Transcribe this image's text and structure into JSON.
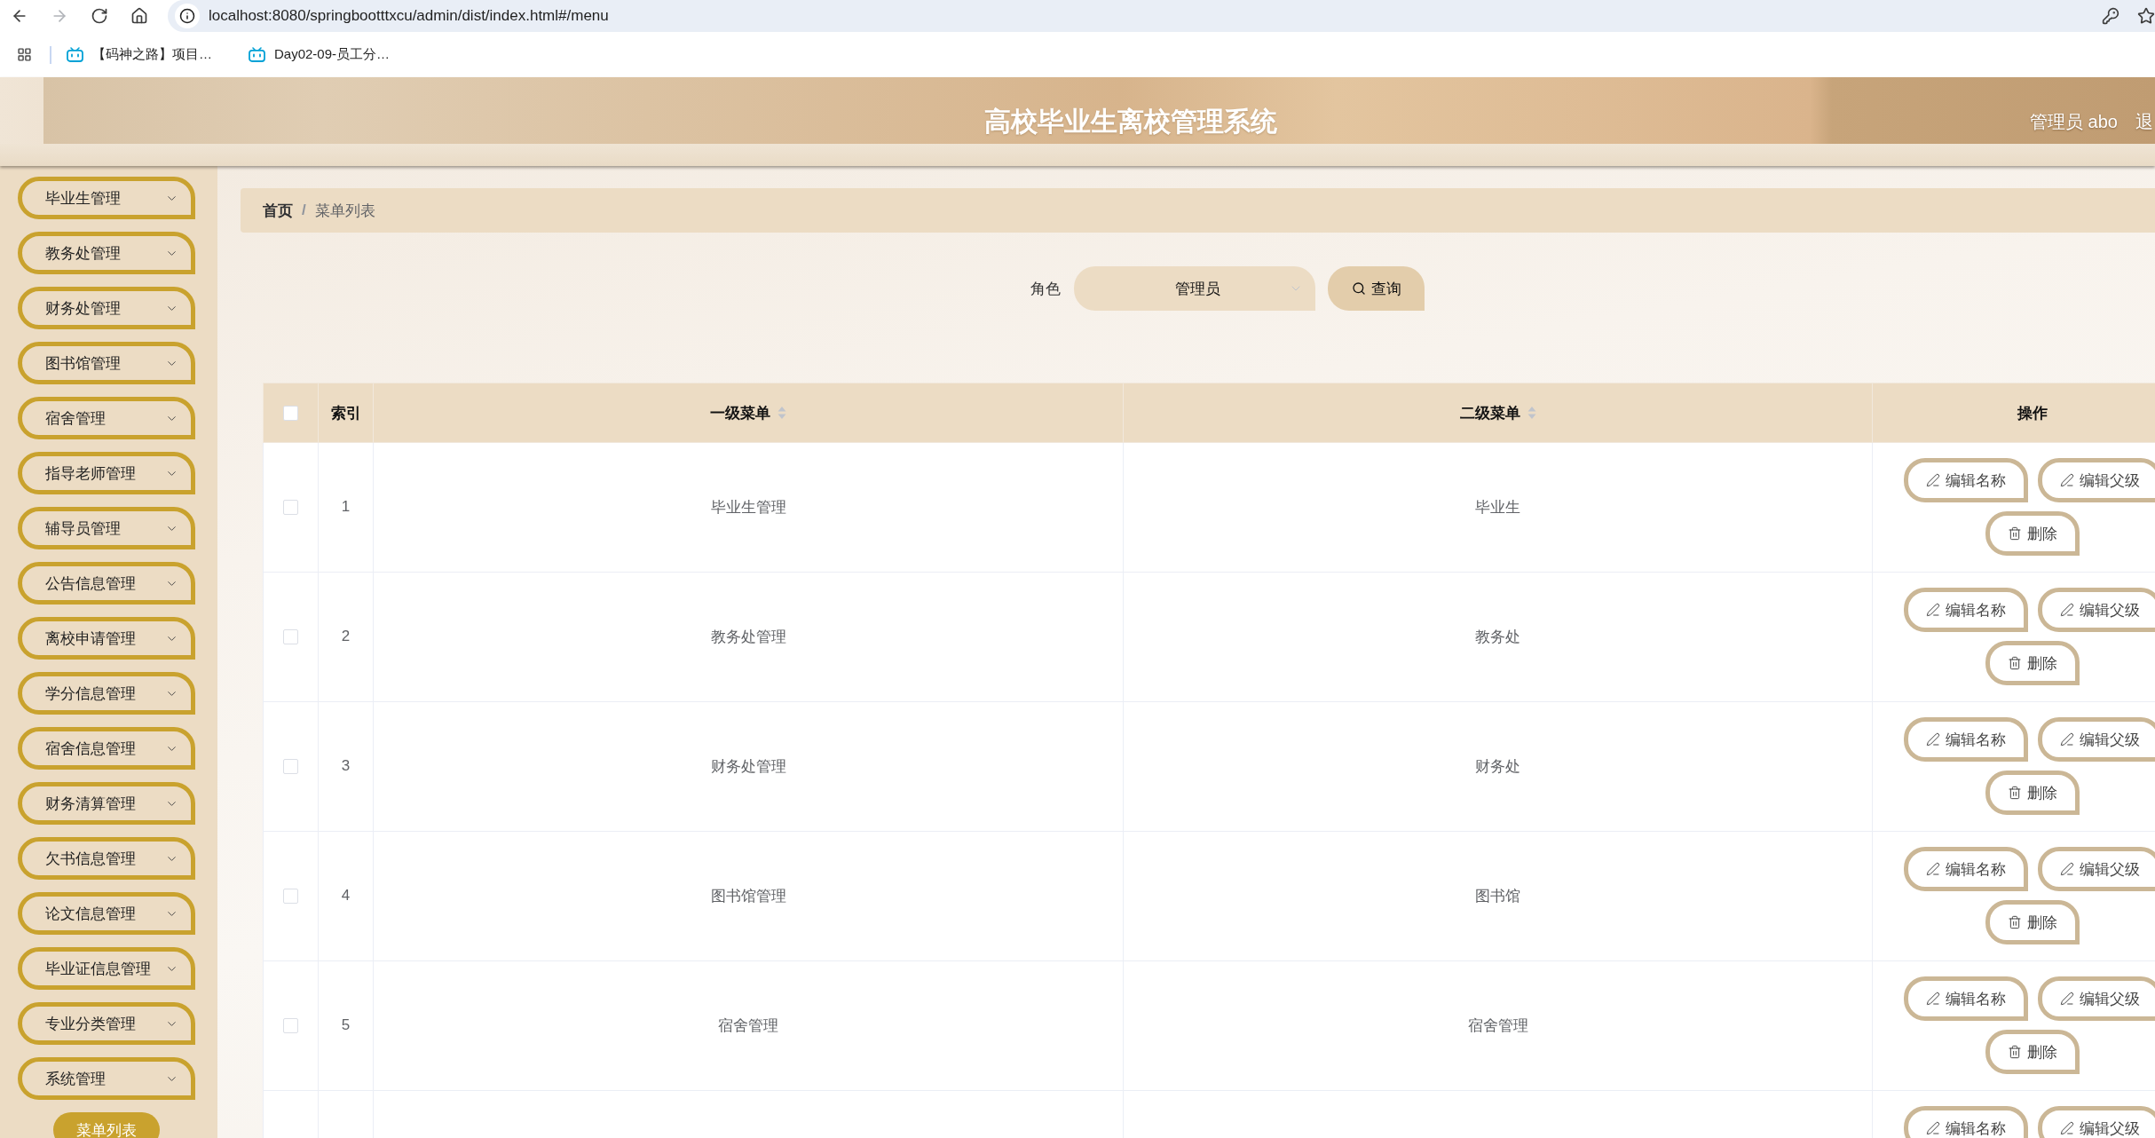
{
  "browser": {
    "url": "localhost:8080/springbootttxcu/admin/dist/index.html#/menu",
    "bookmarks": [
      {
        "label": "【码神之路】项目…"
      },
      {
        "label": "Day02-09-员工分…"
      }
    ]
  },
  "header": {
    "title": "高校毕业生离校管理系统",
    "user": "管理员 abo",
    "logout": "退"
  },
  "sidebar": {
    "items": [
      {
        "label": "毕业生管理"
      },
      {
        "label": "教务处管理"
      },
      {
        "label": "财务处管理"
      },
      {
        "label": "图书馆管理"
      },
      {
        "label": "宿舍管理"
      },
      {
        "label": "指导老师管理"
      },
      {
        "label": "辅导员管理"
      },
      {
        "label": "公告信息管理"
      },
      {
        "label": "离校申请管理"
      },
      {
        "label": "学分信息管理"
      },
      {
        "label": "宿舍信息管理"
      },
      {
        "label": "财务清算管理"
      },
      {
        "label": "欠书信息管理"
      },
      {
        "label": "论文信息管理"
      },
      {
        "label": "毕业证信息管理"
      },
      {
        "label": "专业分类管理"
      },
      {
        "label": "系统管理",
        "children": [
          {
            "label": "菜单列表",
            "selected": true
          }
        ]
      }
    ]
  },
  "breadcrumb": {
    "items": [
      "首页",
      "菜单列表"
    ],
    "separator": "/"
  },
  "search": {
    "label": "角色",
    "select": {
      "value": "管理员"
    },
    "button": "查询"
  },
  "table": {
    "columns": [
      {
        "kind": "checkbox",
        "checked": false
      },
      {
        "kind": "text",
        "label": "索引",
        "sortable": false
      },
      {
        "kind": "text",
        "label": "一级菜单",
        "sortable": true
      },
      {
        "kind": "text",
        "label": "二级菜单",
        "sortable": true
      },
      {
        "kind": "text",
        "label": "操作",
        "sortable": false
      }
    ],
    "rows": [
      {
        "checked": false,
        "index": "1",
        "first_level": "毕业生管理",
        "second_level": "毕业生",
        "actions": [
          {
            "kind": "edit",
            "label": "编辑名称"
          },
          {
            "kind": "edit",
            "label": "编辑父级"
          },
          {
            "kind": "delete",
            "label": "删除"
          }
        ]
      },
      {
        "checked": false,
        "index": "2",
        "first_level": "教务处管理",
        "second_level": "教务处",
        "actions": [
          {
            "kind": "edit",
            "label": "编辑名称"
          },
          {
            "kind": "edit",
            "label": "编辑父级"
          },
          {
            "kind": "delete",
            "label": "删除"
          }
        ]
      },
      {
        "checked": false,
        "index": "3",
        "first_level": "财务处管理",
        "second_level": "财务处",
        "actions": [
          {
            "kind": "edit",
            "label": "编辑名称"
          },
          {
            "kind": "edit",
            "label": "编辑父级"
          },
          {
            "kind": "delete",
            "label": "删除"
          }
        ]
      },
      {
        "checked": false,
        "index": "4",
        "first_level": "图书馆管理",
        "second_level": "图书馆",
        "actions": [
          {
            "kind": "edit",
            "label": "编辑名称"
          },
          {
            "kind": "edit",
            "label": "编辑父级"
          },
          {
            "kind": "delete",
            "label": "删除"
          }
        ]
      },
      {
        "checked": false,
        "index": "5",
        "first_level": "宿舍管理",
        "second_level": "宿舍管理",
        "actions": [
          {
            "kind": "edit",
            "label": "编辑名称"
          },
          {
            "kind": "edit",
            "label": "编辑父级"
          },
          {
            "kind": "delete",
            "label": "删除"
          }
        ]
      },
      {
        "actions": [
          {
            "kind": "edit",
            "label": "编辑名称"
          },
          {
            "kind": "edit",
            "label": "编辑父级"
          }
        ]
      }
    ]
  }
}
